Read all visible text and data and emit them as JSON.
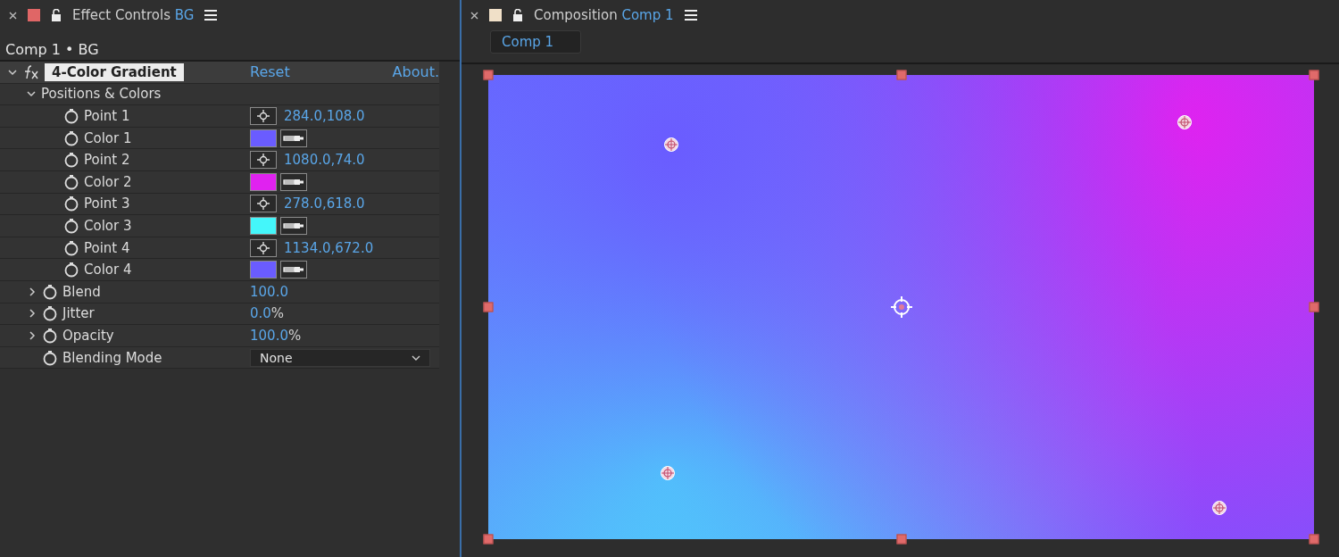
{
  "effect_panel": {
    "title": "Effect Controls",
    "layer": "BG",
    "color": "#e06666",
    "breadcrumb": "Comp 1 • BG",
    "effect": {
      "name": "4-Color Gradient",
      "expanded": true,
      "reset": "Reset",
      "about": "About.",
      "group": {
        "label": "Positions & Colors",
        "expanded": true,
        "items": [
          {
            "kind": "point",
            "label": "Point 1",
            "value": "284.0,108.0"
          },
          {
            "kind": "color",
            "label": "Color 1",
            "color": "#6a5cff"
          },
          {
            "kind": "point",
            "label": "Point 2",
            "value": "1080.0,74.0"
          },
          {
            "kind": "color",
            "label": "Color 2",
            "color": "#e022f0"
          },
          {
            "kind": "point",
            "label": "Point 3",
            "value": "278.0,618.0"
          },
          {
            "kind": "color",
            "label": "Color 3",
            "color": "#44f6fa"
          },
          {
            "kind": "point",
            "label": "Point 4",
            "value": "1134.0,672.0"
          },
          {
            "kind": "color",
            "label": "Color 4",
            "color": "#6a5cff"
          }
        ]
      },
      "params": [
        {
          "kind": "number",
          "label": "Blend",
          "value": "100.0",
          "expanded": false
        },
        {
          "kind": "number",
          "label": "Jitter",
          "value": "0.0",
          "unit": "%",
          "expanded": false
        },
        {
          "kind": "number",
          "label": "Opacity",
          "value": "100.0",
          "unit": "%",
          "expanded": false
        },
        {
          "kind": "dropdown",
          "label": "Blending Mode",
          "value": "None"
        }
      ]
    }
  },
  "comp_panel": {
    "title": "Composition",
    "comp": "Comp 1",
    "color": "#f0e0c8",
    "tab": {
      "label": "Comp 1",
      "selected": true
    }
  }
}
